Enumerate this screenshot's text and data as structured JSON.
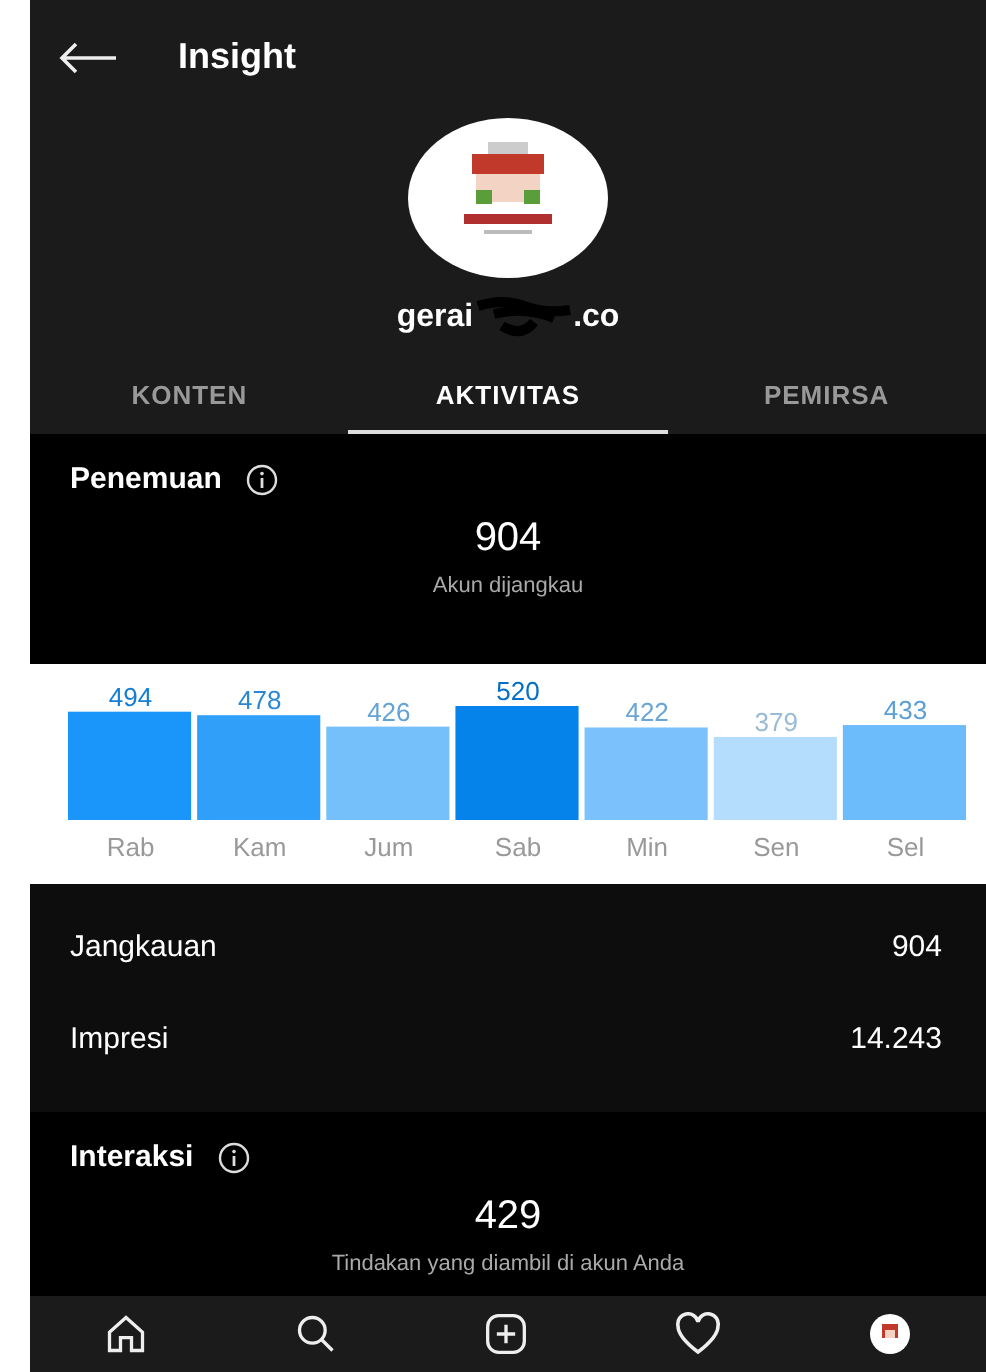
{
  "header": {
    "title": "Insight"
  },
  "profile": {
    "username_start": "gerai",
    "username_end": ".co"
  },
  "tabs": [
    {
      "label": "KONTEN",
      "selected": false
    },
    {
      "label": "AKTIVITAS",
      "selected": true
    },
    {
      "label": "PEMIRSA",
      "selected": false
    }
  ],
  "discovery": {
    "title": "Penemuan",
    "value": "904",
    "caption": "Akun dijangkau",
    "chart_data": {
      "type": "bar",
      "categories": [
        "Rab",
        "Kam",
        "Jum",
        "Sab",
        "Min",
        "Sen",
        "Sel"
      ],
      "series": [
        {
          "values": [
            494,
            478,
            426,
            520,
            422,
            379,
            433
          ]
        }
      ],
      "data_labels": true
    }
  },
  "metrics": [
    {
      "label": "Jangkauan",
      "value": "904"
    },
    {
      "label": "Impresi",
      "value": "14.243"
    }
  ],
  "interactions": {
    "title": "Interaksi",
    "value": "429",
    "caption": "Tindakan yang diambil di akun Anda"
  },
  "nav": [
    {
      "kind": "home"
    },
    {
      "kind": "search"
    },
    {
      "kind": "add"
    },
    {
      "kind": "heart"
    },
    {
      "kind": "profile"
    }
  ]
}
